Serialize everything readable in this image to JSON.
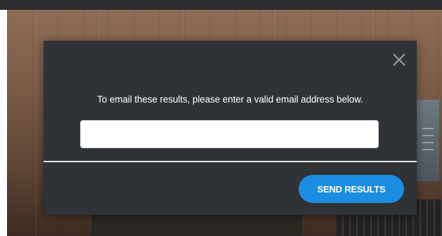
{
  "modal": {
    "message": "To email these results, please enter a valid email address below.",
    "email_input": {
      "value": "",
      "placeholder": ""
    },
    "send_button_label": "SEND RESULTS",
    "close_icon": "close-icon"
  },
  "colors": {
    "modal_background": "#2f3236",
    "send_button": "#1a8de0",
    "divider": "#e8e8e8",
    "close_icon": "#9aa0a6"
  }
}
